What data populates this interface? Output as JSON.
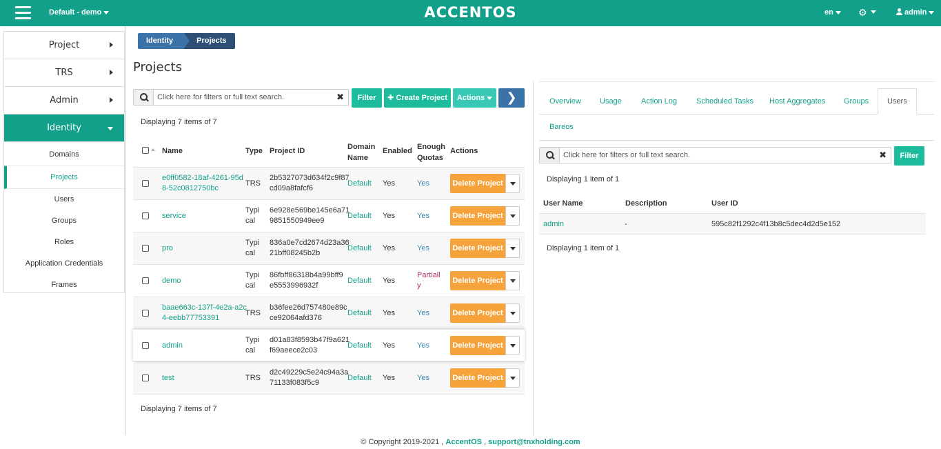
{
  "header": {
    "project_switcher": "Default - demo",
    "brand": "ACCENTOS",
    "language": "en",
    "user": "admin"
  },
  "sidebar": {
    "sections": [
      {
        "label": "Project"
      },
      {
        "label": "TRS"
      },
      {
        "label": "Admin"
      },
      {
        "label": "Identity"
      }
    ],
    "identity_items": [
      "Domains",
      "Projects",
      "Users",
      "Groups",
      "Roles",
      "Application Credentials",
      "Frames"
    ]
  },
  "breadcrumb": [
    "Identity",
    "Projects"
  ],
  "page_title": "Projects",
  "left": {
    "search_placeholder": "Click here for filters or full text search.",
    "filter_label": "Filter",
    "create_label": "Create Project",
    "actions_label": "Actions",
    "displaying_top": "Displaying 7 items of 7",
    "displaying_bottom": "Displaying 7 items of 7",
    "columns": {
      "name": "Name",
      "type": "Type",
      "project_id": "Project ID",
      "domain_name_1": "Domain",
      "domain_name_2": "Name",
      "enabled": "Enabled",
      "quotas_1": "Enough",
      "quotas_2": "Quotas",
      "actions": "Actions"
    },
    "delete_label": "Delete Project",
    "rows": [
      {
        "name1": "e0ff0582-18af-4261-95d",
        "name2": "8-52c0812750bc",
        "type1": "TRS",
        "type2": "",
        "id1": "2b5327073d634f2c9f87",
        "id2": "cd09a8fafcf6",
        "domain": "Default",
        "enabled": "Yes",
        "quota1": "Yes",
        "quota2": ""
      },
      {
        "name1": "service",
        "name2": "",
        "type1": "Typi",
        "type2": "cal",
        "id1": "6e928e569be145e6a71",
        "id2": "9851550949ee9",
        "domain": "Default",
        "enabled": "Yes",
        "quota1": "Yes",
        "quota2": ""
      },
      {
        "name1": "pro",
        "name2": "",
        "type1": "Typi",
        "type2": "cal",
        "id1": "836a0e7cd2674d23a36",
        "id2": "21bff08245b2b",
        "domain": "Default",
        "enabled": "Yes",
        "quota1": "Yes",
        "quota2": ""
      },
      {
        "name1": "demo",
        "name2": "",
        "type1": "Typi",
        "type2": "cal",
        "id1": "86fbff86318b4a99bff9",
        "id2": "e5553996932f",
        "domain": "Default",
        "enabled": "Yes",
        "quota1": "Partiall",
        "quota2": "y"
      },
      {
        "name1": "baae663c-137f-4e2a-a2c",
        "name2": "4-eebb77753391",
        "type1": "TRS",
        "type2": "",
        "id1": "b36fee26d757480e89c",
        "id2": "ce92064afd376",
        "domain": "Default",
        "enabled": "Yes",
        "quota1": "Yes",
        "quota2": ""
      },
      {
        "name1": "admin",
        "name2": "",
        "type1": "Typi",
        "type2": "cal",
        "id1": "d01a83f8593b47f9a621",
        "id2": "f69aeece2c03",
        "domain": "Default",
        "enabled": "Yes",
        "quota1": "Yes",
        "quota2": ""
      },
      {
        "name1": "test",
        "name2": "",
        "type1": "TRS",
        "type2": "",
        "id1": "d2c49229c5e24c94a3a",
        "id2": "71133f083f5c9",
        "domain": "Default",
        "enabled": "Yes",
        "quota1": "Yes",
        "quota2": ""
      }
    ]
  },
  "right": {
    "tabs": [
      "Overview",
      "Usage",
      "Action Log",
      "Scheduled Tasks",
      "Host Aggregates",
      "Groups",
      "Users",
      "Bareos"
    ],
    "search_placeholder": "Click here for filters or full text search.",
    "filter_label": "Filter",
    "displaying_top": "Displaying 1 item of 1",
    "displaying_bottom": "Displaying 1 item of 1",
    "columns": {
      "user_name": "User Name",
      "description": "Description",
      "user_id": "User ID"
    },
    "row": {
      "user_name": "admin",
      "description": "-",
      "user_id": "595c82f1292c4f13b8c5dec4d2d5e152"
    }
  },
  "footer": {
    "copyright": "© Copyright 2019-2021 , ",
    "brand": "AccentOS",
    "separator": " , ",
    "email": "support@tnxholding.com"
  }
}
